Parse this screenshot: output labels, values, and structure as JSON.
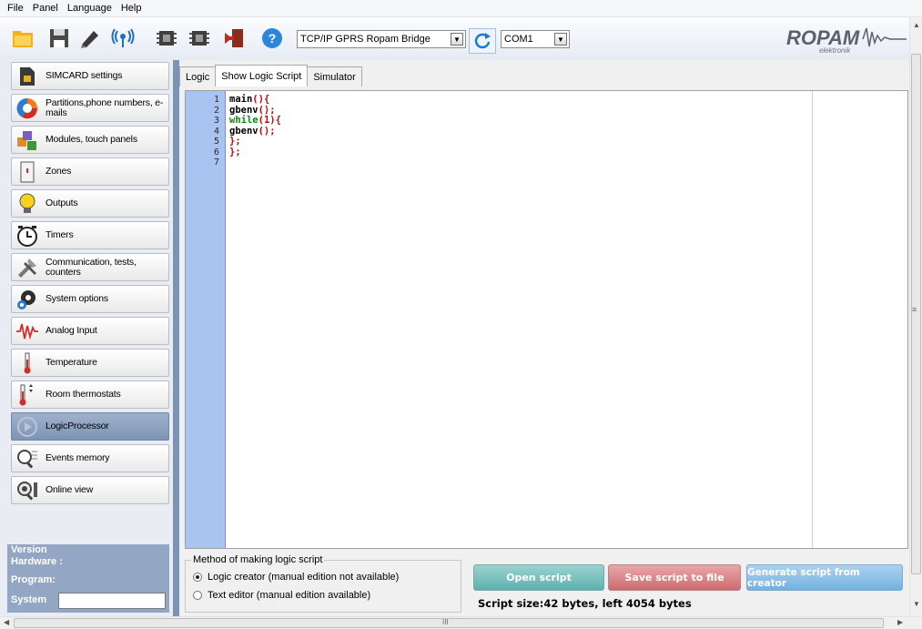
{
  "menu": [
    "File",
    "Panel",
    "Language",
    "Help"
  ],
  "toolbar": {
    "connection": "TCP/IP GPRS Ropam Bridge",
    "port": "COM1",
    "icons": [
      "folder-open-icon",
      "save-icon",
      "pen-icon",
      "antenna-icon",
      "chip-read-icon",
      "chip-write-icon",
      "exit-door-icon",
      "help-icon",
      "refresh-icon"
    ]
  },
  "logo": {
    "brand": "ROPAM",
    "sub": "elektronik"
  },
  "sidebar": {
    "items": [
      {
        "label": "SIMCARD settings",
        "icon": "simcard-icon"
      },
      {
        "label": "Partitions,phone numbers, e-mails",
        "icon": "pie-chart-icon"
      },
      {
        "label": "Modules, touch panels",
        "icon": "modules-icon"
      },
      {
        "label": "Zones",
        "icon": "zone-door-icon"
      },
      {
        "label": "Outputs",
        "icon": "bulb-icon"
      },
      {
        "label": "Timers",
        "icon": "timer-icon"
      },
      {
        "label": "Communication, tests, counters",
        "icon": "tools-icon"
      },
      {
        "label": "System options",
        "icon": "gear-icon"
      },
      {
        "label": "Analog Input",
        "icon": "waveform-icon"
      },
      {
        "label": "Temperature",
        "icon": "thermometer-icon"
      },
      {
        "label": "Room thermostats",
        "icon": "room-thermostat-icon"
      },
      {
        "label": "LogicProcessor",
        "icon": "logic-processor-icon"
      },
      {
        "label": "Events memory",
        "icon": "events-memory-icon"
      },
      {
        "label": "Online view",
        "icon": "online-view-icon"
      }
    ],
    "version": {
      "legend": "Version",
      "hardware": "Hardware :",
      "program": "Program:",
      "system": "System"
    }
  },
  "tabs": [
    "Logic",
    "Show Logic Script",
    "Simulator"
  ],
  "editor": {
    "lines": [
      {
        "n": "1",
        "parts": [
          {
            "t": "main",
            "c": "#000000"
          },
          {
            "t": "(){",
            "c": "#cc0000"
          }
        ]
      },
      {
        "n": "2",
        "parts": [
          {
            "t": "gbenv",
            "c": "#000000"
          },
          {
            "t": "();",
            "c": "#cc0000"
          }
        ]
      },
      {
        "n": "3",
        "parts": [
          {
            "t": "while",
            "c": "#0a8a0a"
          },
          {
            "t": "(",
            "c": "#cc0000"
          },
          {
            "t": "1",
            "c": "#cc0000"
          },
          {
            "t": "){",
            "c": "#cc0000"
          }
        ]
      },
      {
        "n": "4",
        "parts": [
          {
            "t": "gbenv",
            "c": "#000000"
          },
          {
            "t": "();",
            "c": "#cc0000"
          }
        ]
      },
      {
        "n": "5",
        "parts": [
          {
            "t": "};",
            "c": "#cc0000"
          }
        ]
      },
      {
        "n": "6",
        "parts": [
          {
            "t": "};",
            "c": "#cc0000"
          }
        ]
      },
      {
        "n": "7",
        "parts": []
      }
    ]
  },
  "method": {
    "legend": "Method of making logic script",
    "option1": "Logic creator (manual edition not available)",
    "option2": "Text editor (manual edition available)",
    "selected": 1
  },
  "buttons": {
    "open": "Open script",
    "save": "Save script to file",
    "generate": "Generate script from creator"
  },
  "script_size": "Script size:42 bytes, left 4054 bytes",
  "hscroll_mark": "III",
  "vscroll_mark": "≡"
}
